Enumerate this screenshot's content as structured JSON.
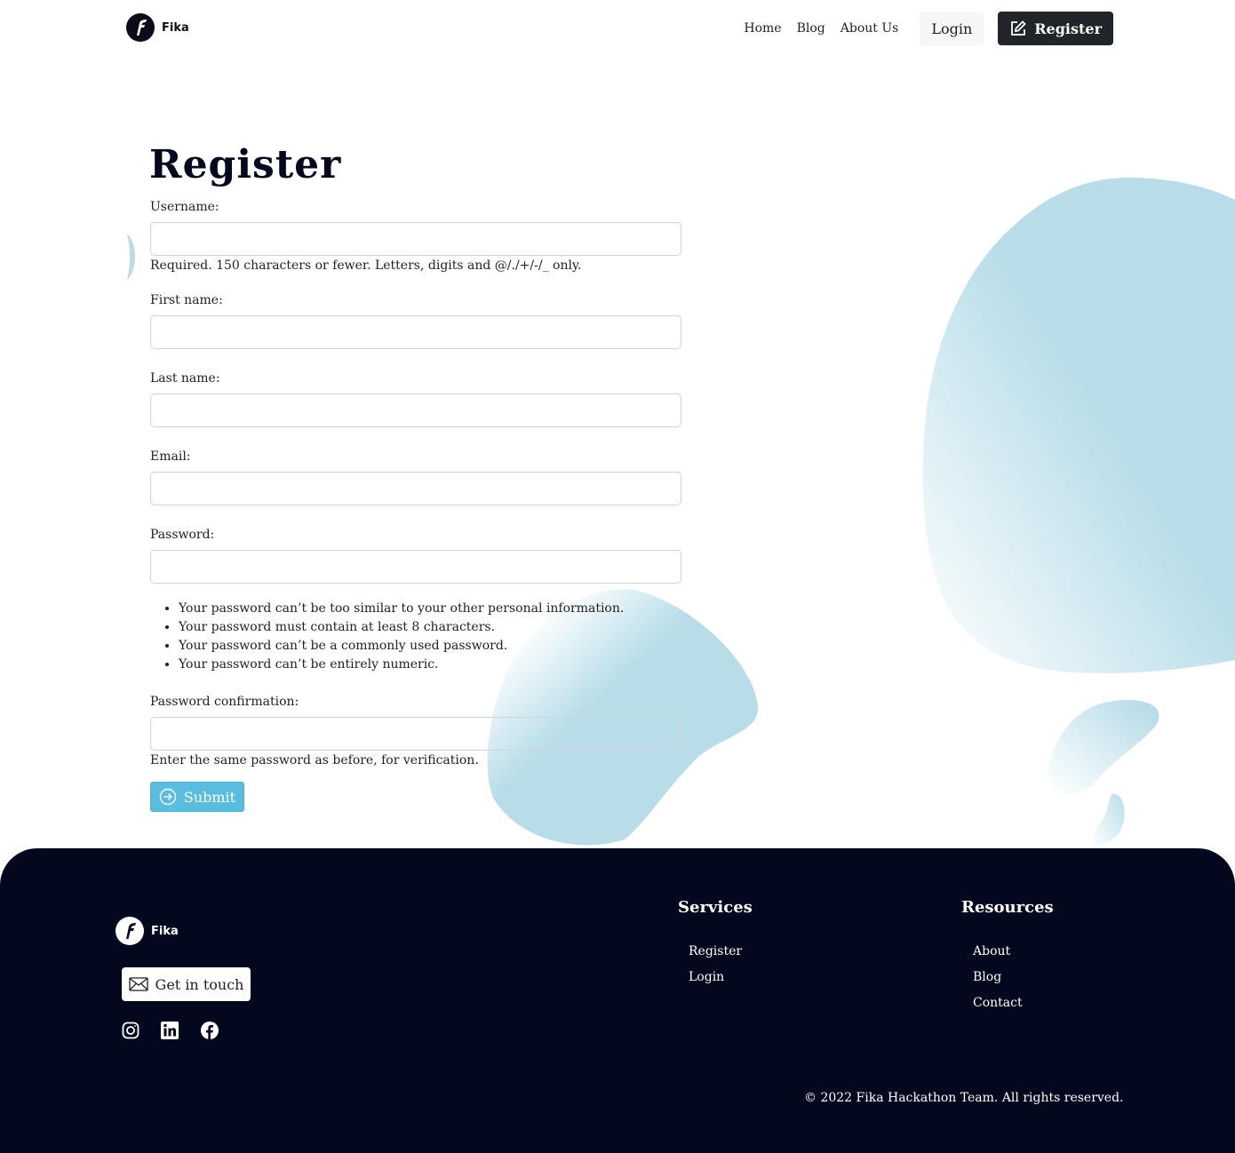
{
  "header": {
    "logo_text": "Fika",
    "nav": [
      "Home",
      "Blog",
      "About Us"
    ],
    "login_label": "Login",
    "register_label": "Register"
  },
  "form": {
    "title": "Register",
    "username_label": "Username:",
    "username_help": "Required. 150 characters or fewer. Letters, digits and @/./+/-/_ only.",
    "first_name_label": "First name:",
    "last_name_label": "Last name:",
    "email_label": "Email:",
    "password_label": "Password:",
    "password_rules": [
      "Your password can’t be too similar to your other personal information.",
      "Your password must contain at least 8 characters.",
      "Your password can’t be a commonly used password.",
      "Your password can’t be entirely numeric."
    ],
    "password2_label": "Password confirmation:",
    "password2_help": "Enter the same password as before, for verification.",
    "submit_label": "Submit"
  },
  "footer": {
    "logo_text": "Fika",
    "get_in_touch_label": "Get in touch",
    "social_icons": [
      "instagram-icon",
      "linkedin-icon",
      "facebook-icon"
    ],
    "services_heading": "Services",
    "services_links": [
      "Register",
      "Login"
    ],
    "resources_heading": "Resources",
    "resources_links": [
      "About",
      "Blog",
      "Contact"
    ],
    "copyright": "© 2022 Fika Hackathon Team. All rights reserved."
  },
  "colors": {
    "accent": "#59bde0",
    "blob": "#b8dde9",
    "footer_bg": "#04081f",
    "dark_button": "#212529"
  }
}
